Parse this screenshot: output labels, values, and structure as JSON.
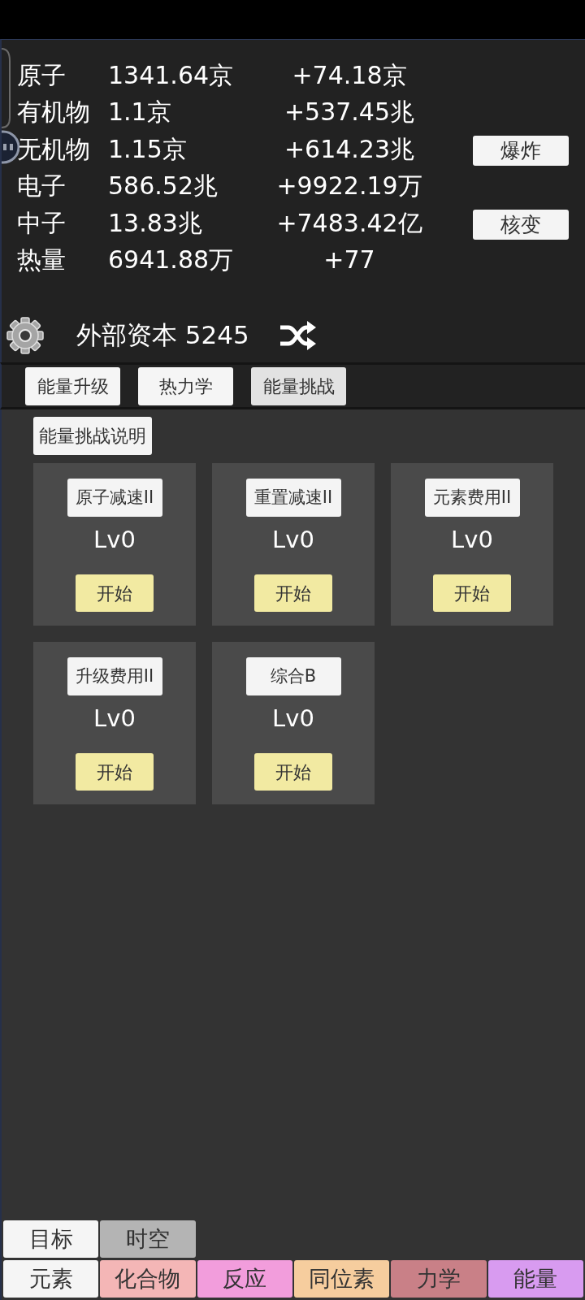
{
  "resources": [
    {
      "name": "原子",
      "amount": "1341.64京",
      "rate": "+74.18京"
    },
    {
      "name": "有机物",
      "amount": "1.1京",
      "rate": "+537.45兆"
    },
    {
      "name": "无机物",
      "amount": "1.15京",
      "rate": "+614.23兆",
      "button": "爆炸"
    },
    {
      "name": "电子",
      "amount": "586.52兆",
      "rate": "+9922.19万"
    },
    {
      "name": "中子",
      "amount": "13.83兆",
      "rate": "+7483.42亿",
      "button": "核变"
    },
    {
      "name": "热量",
      "amount": "6941.88万",
      "rate": "+77"
    }
  ],
  "capital": {
    "label": "外部资本 5245"
  },
  "tabs": [
    {
      "label": "能量升级",
      "selected": false
    },
    {
      "label": "热力学",
      "selected": false
    },
    {
      "label": "能量挑战",
      "selected": true
    }
  ],
  "info_button": "能量挑战说明",
  "challenges": [
    {
      "name": "原子减速II",
      "level": "Lv0",
      "button": "开始"
    },
    {
      "name": "重置减速II",
      "level": "Lv0",
      "button": "开始"
    },
    {
      "name": "元素费用II",
      "level": "Lv0",
      "button": "开始"
    },
    {
      "name": "升级费用II",
      "level": "Lv0",
      "button": "开始"
    },
    {
      "name": "综合B",
      "level": "Lv0",
      "button": "开始"
    }
  ],
  "bottom_tabs_top": [
    {
      "label": "目标",
      "color": "#f5f5f5"
    },
    {
      "label": "时空",
      "color": "#b4b4b4"
    }
  ],
  "bottom_tabs": [
    {
      "label": "元素",
      "color": "#f5f5f5"
    },
    {
      "label": "化合物",
      "color": "#f4b6b6"
    },
    {
      "label": "反应",
      "color": "#f29ddc"
    },
    {
      "label": "同位素",
      "color": "#f6cd9e"
    },
    {
      "label": "力学",
      "color": "#c98087"
    },
    {
      "label": "能量",
      "color": "#d89bf0"
    }
  ]
}
